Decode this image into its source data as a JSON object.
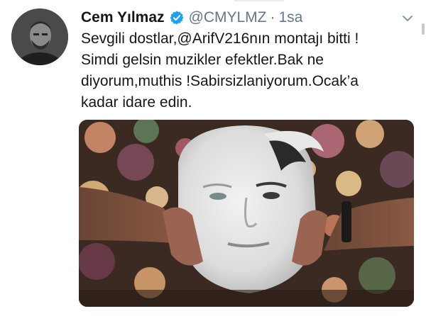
{
  "tweet": {
    "display_name": "Cem Yılmaz",
    "handle": "@CMYLMZ",
    "separator": "·",
    "time": "1sa",
    "text_lines": [
      "Sevgili dostlar,@ArifV216nın montajı bitti !",
      "Simdi gelsin muzikler efektler.Bak ne",
      "diyorum,muthis !Sabirsizlaniyorum.Ocak’a",
      "kadar idare edin."
    ]
  },
  "icons": {
    "verified": "verified-badge-icon",
    "more": "chevron-down-icon"
  },
  "colors": {
    "name": "#14171a",
    "secondary": "#657786",
    "verified": "#1da1f2"
  }
}
